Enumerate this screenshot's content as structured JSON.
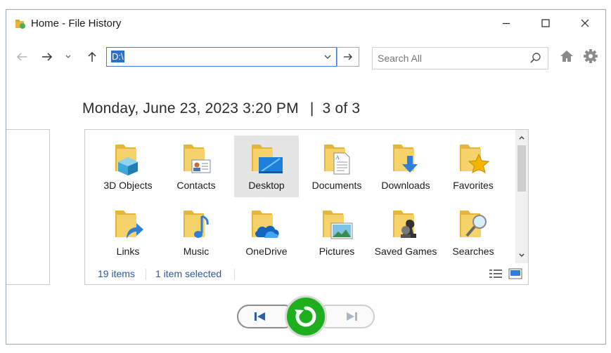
{
  "window": {
    "title": "Home - File History",
    "app_icon": "file-history-icon",
    "minimize_icon": "minimize-icon",
    "maximize_icon": "maximize-icon",
    "close_icon": "close-icon"
  },
  "navigation": {
    "back_icon": "back-arrow-icon",
    "forward_icon": "forward-arrow-icon",
    "recent_icon": "chevron-down-icon",
    "up_icon": "up-arrow-icon",
    "address_value": "D:\\",
    "go_icon": "go-arrow-icon",
    "search_placeholder": "Search All",
    "home_icon": "home-icon",
    "settings_icon": "gear-icon"
  },
  "snapshot": {
    "datetime": "Monday, June 23, 2023 3:20 PM",
    "separator": "|",
    "position": "3 of 3"
  },
  "items": [
    {
      "label": "3D Objects",
      "icon": "3d-objects-folder-icon",
      "selected": false
    },
    {
      "label": "Contacts",
      "icon": "contacts-folder-icon",
      "selected": false
    },
    {
      "label": "Desktop",
      "icon": "desktop-folder-icon",
      "selected": true
    },
    {
      "label": "Documents",
      "icon": "documents-folder-icon",
      "selected": false
    },
    {
      "label": "Downloads",
      "icon": "downloads-folder-icon",
      "selected": false
    },
    {
      "label": "Favorites",
      "icon": "favorites-folder-icon",
      "selected": false
    },
    {
      "label": "Links",
      "icon": "links-folder-icon",
      "selected": false
    },
    {
      "label": "Music",
      "icon": "music-folder-icon",
      "selected": false
    },
    {
      "label": "OneDrive",
      "icon": "onedrive-folder-icon",
      "selected": false
    },
    {
      "label": "Pictures",
      "icon": "pictures-folder-icon",
      "selected": false
    },
    {
      "label": "Saved Games",
      "icon": "saved-games-folder-icon",
      "selected": false
    },
    {
      "label": "Searches",
      "icon": "searches-folder-icon",
      "selected": false
    }
  ],
  "status": {
    "item_count": "19 items",
    "selection": "1 item selected"
  },
  "controls": {
    "previous_icon": "previous-version-icon",
    "restore_icon": "restore-icon",
    "next_icon": "next-version-icon"
  },
  "colors": {
    "folder": "#f3c94a",
    "accent": "#2d6fc9",
    "restore_green": "#1eae1e"
  }
}
